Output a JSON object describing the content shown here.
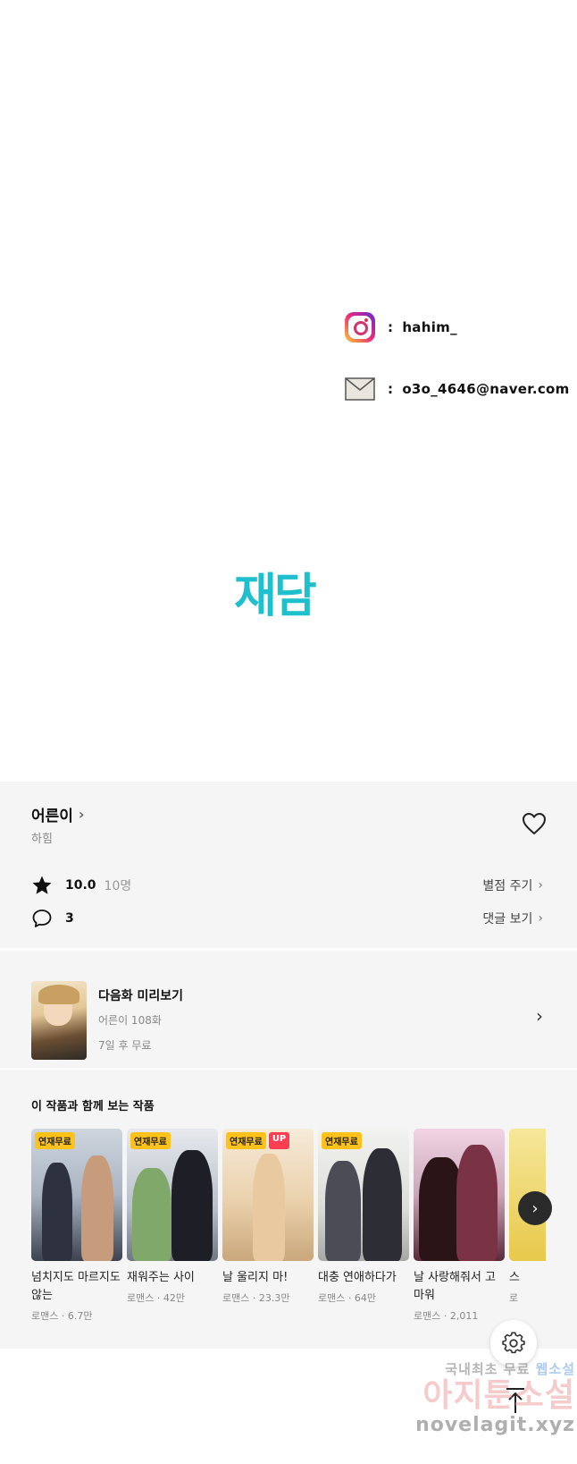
{
  "contacts": {
    "instagram": {
      "icon": "instagram-icon",
      "colon": ":",
      "value": "hahim_"
    },
    "email": {
      "icon": "mail-icon",
      "colon": ":",
      "value": "o3o_4646@naver.com"
    }
  },
  "logo": "재담",
  "series": {
    "title": "어른이",
    "author": "하힘",
    "rating": "10.0",
    "rating_count": "10명",
    "rate_link": "별점 주기",
    "comments": "3",
    "comments_link": "댓글 보기"
  },
  "next_episode": {
    "title": "다음화 미리보기",
    "episode": "어른이 108화",
    "free_info": "7일 후 무료"
  },
  "recommendations": {
    "heading": "이 작품과 함께 보는 작품",
    "items": [
      {
        "title": "넘치지도 마르지도 않는",
        "genre": "로맨스",
        "count": "6.7만",
        "badges": [
          "연재무료"
        ]
      },
      {
        "title": "재워주는 사이",
        "genre": "로맨스",
        "count": "42만",
        "badges": [
          "연재무료"
        ]
      },
      {
        "title": "날 울리지 마!",
        "genre": "로맨스",
        "count": "23.3만",
        "badges": [
          "연재무료",
          "UP"
        ]
      },
      {
        "title": "대충 연애하다가",
        "genre": "로맨스",
        "count": "64만",
        "badges": [
          "연재무료"
        ]
      },
      {
        "title": "날 사랑해줘서 고마워",
        "genre": "로맨스",
        "count": "2,011",
        "badges": []
      },
      {
        "title": "스",
        "genre": "로",
        "count": "",
        "badges": []
      }
    ]
  },
  "watermark": {
    "line1_a": "국내최초 무료 ",
    "line1_b": "웹소설",
    "line2": "아지툰소설",
    "url": "novelagit.xyz"
  },
  "colors": {
    "brand": "#1ec0cd",
    "badge": "#ffc21a",
    "badge_up": "#ff3d52",
    "panel": "#f5f5f5"
  }
}
